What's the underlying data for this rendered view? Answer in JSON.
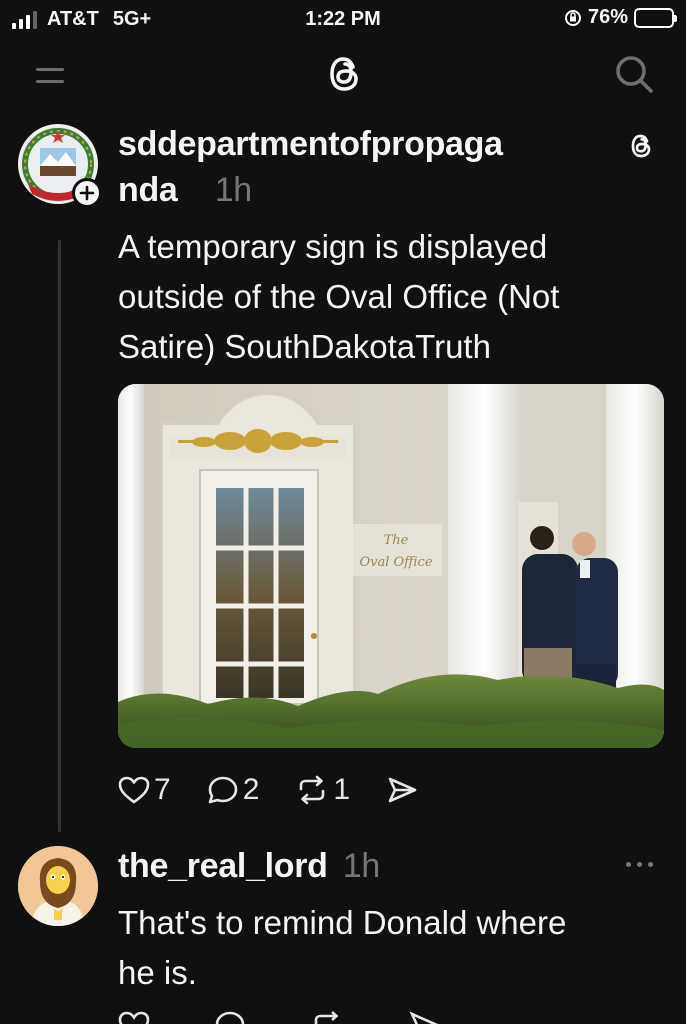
{
  "status_bar": {
    "carrier": "AT&T",
    "network": "5G+",
    "time": "1:22 PM",
    "battery_percent": "76%",
    "battery_level": 0.76
  },
  "nav": {
    "menu_icon": "menu-icon",
    "logo_icon": "threads-logo-icon",
    "search_icon": "search-icon"
  },
  "post": {
    "username_line1": "sddepartmentofpropaga",
    "username_line2": "nda",
    "time": "1h",
    "text_lines": [
      "A temporary sign is displayed",
      "outside of the Oval Office (Not",
      "Satire) SouthDakotaTruth"
    ],
    "photo_sign_line1": "The",
    "photo_sign_line2": "Oval Office",
    "likes": "7",
    "replies": "2",
    "reposts": "1"
  },
  "reply": {
    "username": "the_real_lord",
    "time": "1h",
    "text_lines": [
      "That's to remind Donald where",
      "he is."
    ]
  },
  "colors": {
    "background": "#101010",
    "text": "#f3f5f7",
    "muted": "#777777"
  }
}
